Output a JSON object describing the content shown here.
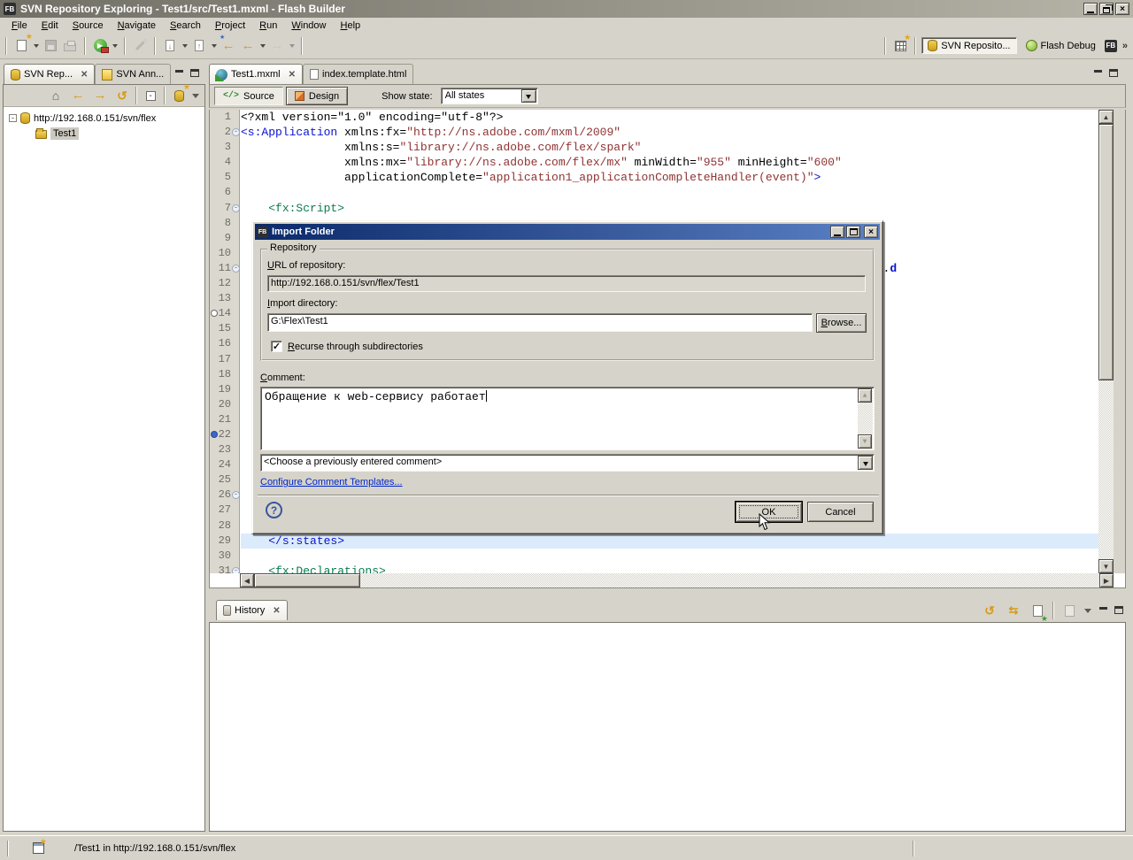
{
  "window": {
    "title": "SVN Repository Exploring - Test1/src/Test1.mxml - Flash Builder",
    "app_badge": "FB"
  },
  "menu": {
    "items": [
      "File",
      "Edit",
      "Source",
      "Navigate",
      "Search",
      "Project",
      "Run",
      "Window",
      "Help"
    ]
  },
  "toolbar": {
    "groups": [
      [
        {
          "name": "new-wizard",
          "glyph": "new",
          "dd": true
        },
        {
          "name": "save",
          "glyph": "floppy",
          "disabled": true
        },
        {
          "name": "print",
          "glyph": "printer",
          "disabled": true
        }
      ],
      [
        {
          "name": "run-configurations",
          "glyph": "run",
          "dd": true
        }
      ],
      [
        {
          "name": "paintbrush",
          "glyph": "brush",
          "disabled": true
        }
      ],
      [
        {
          "name": "next-annotation",
          "glyph": "annot-next",
          "dd": true
        },
        {
          "name": "previous-annotation",
          "glyph": "annot-prev",
          "dd": true
        },
        {
          "name": "last-edit-location",
          "glyph": "arrow-left-star"
        },
        {
          "name": "back",
          "glyph": "arrow-left",
          "dd": true
        },
        {
          "name": "forward",
          "glyph": "arrow-right",
          "disabled": true,
          "dd": true
        }
      ]
    ]
  },
  "perspectives": {
    "selected": "SVN Reposito...",
    "other": "Flash Debug",
    "fb_badge": "FB",
    "overflow": "»"
  },
  "svn_view": {
    "tab_active": "SVN Rep...",
    "tab_inactive": "SVN Ann...",
    "tree_root": "http://192.168.0.151/svn/flex",
    "tree_child": "Test1",
    "expander": "-",
    "collapse_glyph": "-"
  },
  "editor": {
    "tab_active": "Test1.mxml",
    "tab_inactive": "index.template.html",
    "source_label": "Source",
    "design_label": "Design",
    "source_icon_text": "</>",
    "show_state_label": "Show state:",
    "show_state_value": "All states",
    "code": {
      "colors": {
        "tag": "#0a12cf",
        "string": "#8f3333",
        "fx": "#087d4c"
      },
      "lines": [
        {
          "n": 1,
          "segs": [
            [
              "<?xml version=\"1.0\" encoding=\"utf-8\"?>",
              "c0"
            ]
          ]
        },
        {
          "n": 2,
          "fold": true,
          "segs": [
            [
              "<s:Application",
              "c1"
            ],
            [
              " xmlns:fx=",
              "c0"
            ],
            [
              "\"http://ns.adobe.com/mxml/2009\"",
              "c2"
            ]
          ]
        },
        {
          "n": 3,
          "segs": [
            [
              "               xmlns:s=",
              "c0"
            ],
            [
              "\"library://ns.adobe.com/flex/spark\"",
              "c2"
            ]
          ]
        },
        {
          "n": 4,
          "segs": [
            [
              "               xmlns:mx=",
              "c0"
            ],
            [
              "\"library://ns.adobe.com/flex/mx\"",
              "c2"
            ],
            [
              " minWidth=",
              "c0"
            ],
            [
              "\"955\"",
              "c2"
            ],
            [
              " minHeight=",
              "c0"
            ],
            [
              "\"600\"",
              "c2"
            ]
          ]
        },
        {
          "n": 5,
          "segs": [
            [
              "               applicationComplete=",
              "c0"
            ],
            [
              "\"application1_applicationCompleteHandler(event)\"",
              "c2"
            ],
            [
              ">",
              "c1"
            ]
          ]
        },
        {
          "n": 6,
          "segs": []
        },
        {
          "n": 7,
          "fold": true,
          "segs": [
            [
              "    ",
              "c0"
            ],
            [
              "<fx:Script>",
              "c3"
            ]
          ]
        },
        {
          "n": 8,
          "segs": []
        },
        {
          "n": 9,
          "segs": []
        },
        {
          "n": 10,
          "segs": []
        },
        {
          "n": 11,
          "fold": true,
          "segs": [
            [
              "                                                                                             .",
              "c0"
            ],
            [
              "d",
              "c1b"
            ]
          ]
        },
        {
          "n": 12,
          "segs": []
        },
        {
          "n": 13,
          "segs": []
        },
        {
          "n": 14,
          "marker": "hollow",
          "segs": []
        },
        {
          "n": 15,
          "segs": []
        },
        {
          "n": 16,
          "segs": []
        },
        {
          "n": 17,
          "segs": []
        },
        {
          "n": 18,
          "segs": []
        },
        {
          "n": 19,
          "segs": []
        },
        {
          "n": 20,
          "segs": []
        },
        {
          "n": 21,
          "segs": []
        },
        {
          "n": 22,
          "marker": "filled",
          "segs": []
        },
        {
          "n": 23,
          "segs": []
        },
        {
          "n": 24,
          "segs": []
        },
        {
          "n": 25,
          "segs": []
        },
        {
          "n": 26,
          "fold": true,
          "segs": []
        },
        {
          "n": 27,
          "segs": []
        },
        {
          "n": 28,
          "segs": []
        },
        {
          "n": 29,
          "hl": true,
          "segs": [
            [
              "    ",
              "c0"
            ],
            [
              "</s:states>",
              "c1"
            ]
          ]
        },
        {
          "n": 30,
          "segs": []
        },
        {
          "n": 31,
          "fold": true,
          "segs": [
            [
              "    ",
              "c0"
            ],
            [
              "<fx:Declarations>",
              "c3"
            ]
          ]
        }
      ]
    }
  },
  "history": {
    "tab": "History"
  },
  "statusbar": {
    "text": "/Test1 in http://192.168.0.151/svn/flex"
  },
  "dialog": {
    "title": "Import Folder",
    "badge": "FB",
    "group_label": "Repository",
    "url_label": "URL of repository:",
    "url_value": "http://192.168.0.151/svn/flex/Test1",
    "dir_label": "Import directory:",
    "dir_value": "G:\\Flex\\Test1",
    "browse_label": "Browse...",
    "recurse_label": "Recurse through subdirectories",
    "checkbox_glyph": "✓",
    "comment_label": "Comment:",
    "comment_value": "Обращение к web-сервису работает",
    "combo_value": "<Choose a previously entered comment>",
    "link_label": "Configure Comment Templates...",
    "help_glyph": "?",
    "ok_label": "OK",
    "cancel_label": "Cancel"
  },
  "colors": {
    "window_bg": "#d6d3ca",
    "title_inactive_left": "#716f66",
    "title_inactive_right": "#b6b3a7",
    "dialog_title_left": "#0b2a6b",
    "dialog_title_right": "#5b80c4",
    "current_line": "#dcebfb",
    "link": "#0026cc"
  }
}
